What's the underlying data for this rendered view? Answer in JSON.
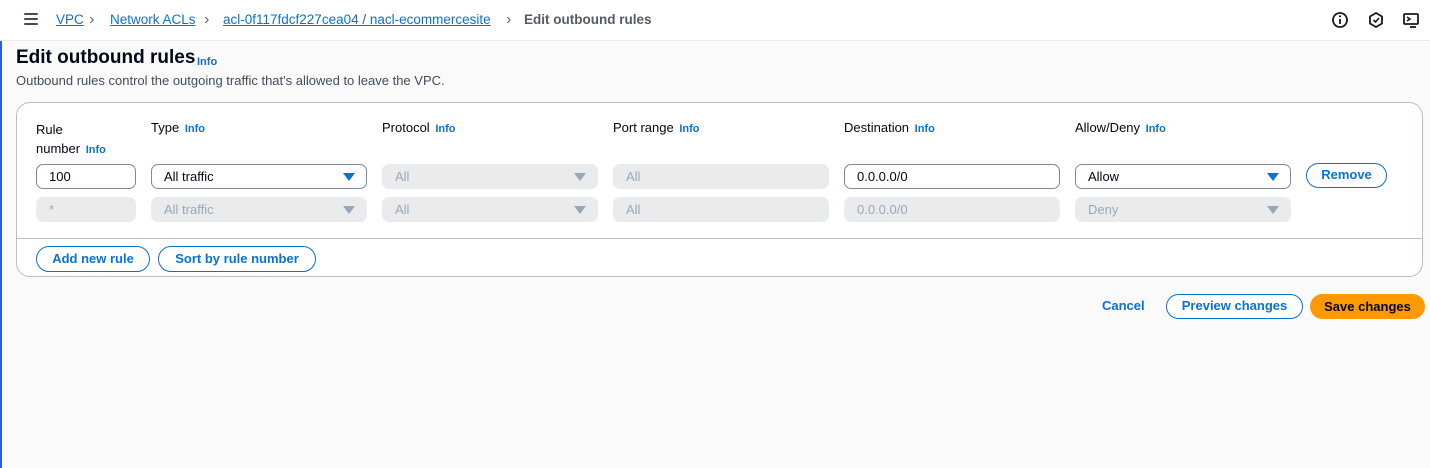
{
  "breadcrumb": {
    "items": [
      "VPC",
      "Network ACLs",
      "acl-0f117fdcf227cea04 / nacl-ecommercesite",
      "Edit outbound rules"
    ]
  },
  "topbar": {
    "icons": [
      "info-circle-icon",
      "feedback-icon",
      "cloudshell-icon"
    ]
  },
  "header": {
    "title": "Edit outbound rules",
    "info": "Info",
    "description": "Outbound rules control the outgoing traffic that's allowed to leave the VPC."
  },
  "columns": {
    "rule_number_line1": "Rule",
    "rule_number_line2": "number",
    "type": "Type",
    "protocol": "Protocol",
    "port_range": "Port range",
    "destination": "Destination",
    "allow_deny": "Allow/Deny",
    "info": "Info"
  },
  "rules": [
    {
      "rule_number": "100",
      "type": "All traffic",
      "protocol": "All",
      "port_range": "All",
      "destination": "0.0.0.0/0",
      "allow_deny": "Allow",
      "remove_label": "Remove"
    },
    {
      "rule_number": "*",
      "type": "All traffic",
      "protocol": "All",
      "port_range": "All",
      "destination": "0.0.0.0/0",
      "allow_deny": "Deny"
    }
  ],
  "panel_actions": {
    "add_rule": "Add new rule",
    "sort": "Sort by rule number"
  },
  "footer": {
    "cancel": "Cancel",
    "preview": "Preview changes",
    "save": "Save changes"
  },
  "colors": {
    "accent": "#0972d3",
    "primary": "#ff9900",
    "border": "#b6bec9"
  }
}
